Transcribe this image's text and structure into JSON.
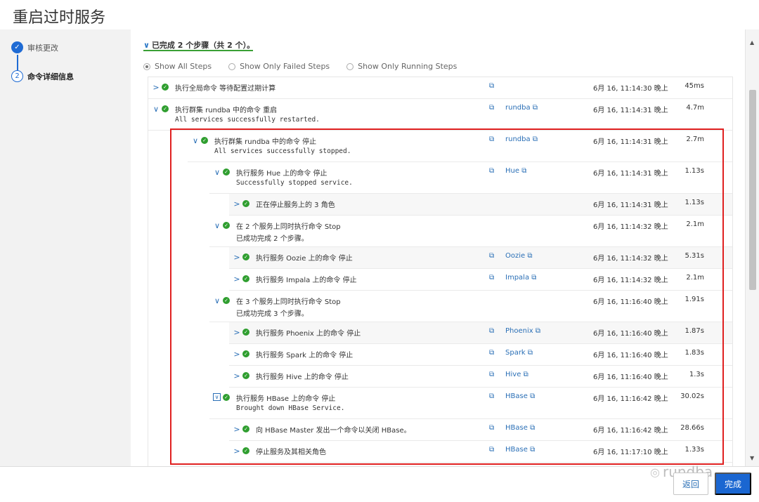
{
  "header": {
    "title": "重启过时服务"
  },
  "wizard": {
    "steps": [
      {
        "label": "审核更改",
        "marker": "✓"
      },
      {
        "label": "命令详细信息",
        "marker": "2"
      }
    ]
  },
  "summary": {
    "caret": "∨",
    "text": "已完成 2 个步骤（共 2 个）。"
  },
  "filters": [
    {
      "label": "Show All Steps",
      "selected": true
    },
    {
      "label": "Show Only Failed Steps",
      "selected": false
    },
    {
      "label": "Show Only Running Steps",
      "selected": false
    }
  ],
  "rows": [
    {
      "expander": ">",
      "title": "执行全局命令 等待配置过期计算",
      "sub": "",
      "link": "",
      "time": "6月 16, 11:14:30 晚上",
      "duration": "45ms"
    },
    {
      "expander": "∨",
      "title": "执行群集 rundba 中的命令 重启",
      "sub": "All services successfully restarted.",
      "link": "rundba",
      "time": "6月 16, 11:14:31 晚上",
      "duration": "4.7m"
    },
    {
      "expander": "∨",
      "title": "执行群集 rundba 中的命令 停止",
      "sub": "All services successfully stopped.",
      "link": "rundba",
      "time": "6月 16, 11:14:31 晚上",
      "duration": "2.7m"
    },
    {
      "expander": "∨",
      "title": "执行服务 Hue 上的命令 停止",
      "sub": "Successfully stopped service.",
      "link": "Hue",
      "time": "6月 16, 11:14:31 晚上",
      "duration": "1.13s"
    },
    {
      "expander": ">",
      "title": "正在停止服务上的 3 角色",
      "sub": "",
      "link": "",
      "time": "6月 16, 11:14:31 晚上",
      "duration": "1.13s"
    },
    {
      "expander": "∨",
      "title": "在 2 个服务上同时执行命令 Stop",
      "sub": "已成功完成 2 个步骤。",
      "link": "",
      "time": "6月 16, 11:14:32 晚上",
      "duration": "2.1m"
    },
    {
      "expander": ">",
      "title": "执行服务 Oozie 上的命令 停止",
      "sub": "",
      "link": "Oozie",
      "time": "6月 16, 11:14:32 晚上",
      "duration": "5.31s"
    },
    {
      "expander": ">",
      "title": "执行服务 Impala 上的命令 停止",
      "sub": "",
      "link": "Impala",
      "time": "6月 16, 11:14:32 晚上",
      "duration": "2.1m"
    },
    {
      "expander": "∨",
      "title": "在 3 个服务上同时执行命令 Stop",
      "sub": "已成功完成 3 个步骤。",
      "link": "",
      "time": "6月 16, 11:16:40 晚上",
      "duration": "1.91s"
    },
    {
      "expander": ">",
      "title": "执行服务 Phoenix 上的命令 停止",
      "sub": "",
      "link": "Phoenix",
      "time": "6月 16, 11:16:40 晚上",
      "duration": "1.87s"
    },
    {
      "expander": ">",
      "title": "执行服务 Spark 上的命令 停止",
      "sub": "",
      "link": "Spark",
      "time": "6月 16, 11:16:40 晚上",
      "duration": "1.83s"
    },
    {
      "expander": ">",
      "title": "执行服务 Hive 上的命令 停止",
      "sub": "",
      "link": "Hive",
      "time": "6月 16, 11:16:40 晚上",
      "duration": "1.3s"
    },
    {
      "expander": "∨",
      "title": "执行服务 HBase 上的命令 停止",
      "sub": "Brought down HBase Service.",
      "link": "HBase",
      "time": "6月 16, 11:16:42 晚上",
      "duration": "30.02s"
    },
    {
      "expander": ">",
      "title": "向 HBase Master 发出一个命令以关闭 HBase。",
      "sub": "",
      "link": "HBase",
      "time": "6月 16, 11:16:42 晚上",
      "duration": "28.66s"
    },
    {
      "expander": ">",
      "title": "停止服务及其相关角色",
      "sub": "",
      "link": "HBase",
      "time": "6月 16, 11:17:10 晚上",
      "duration": "1.33s"
    }
  ],
  "footer": {
    "back_label": "返回",
    "done_label": "完成",
    "watermark": "rundba"
  },
  "colors": {
    "accent": "#1a66d1",
    "success": "#2f9e2f",
    "highlight_box": "#e02020"
  }
}
